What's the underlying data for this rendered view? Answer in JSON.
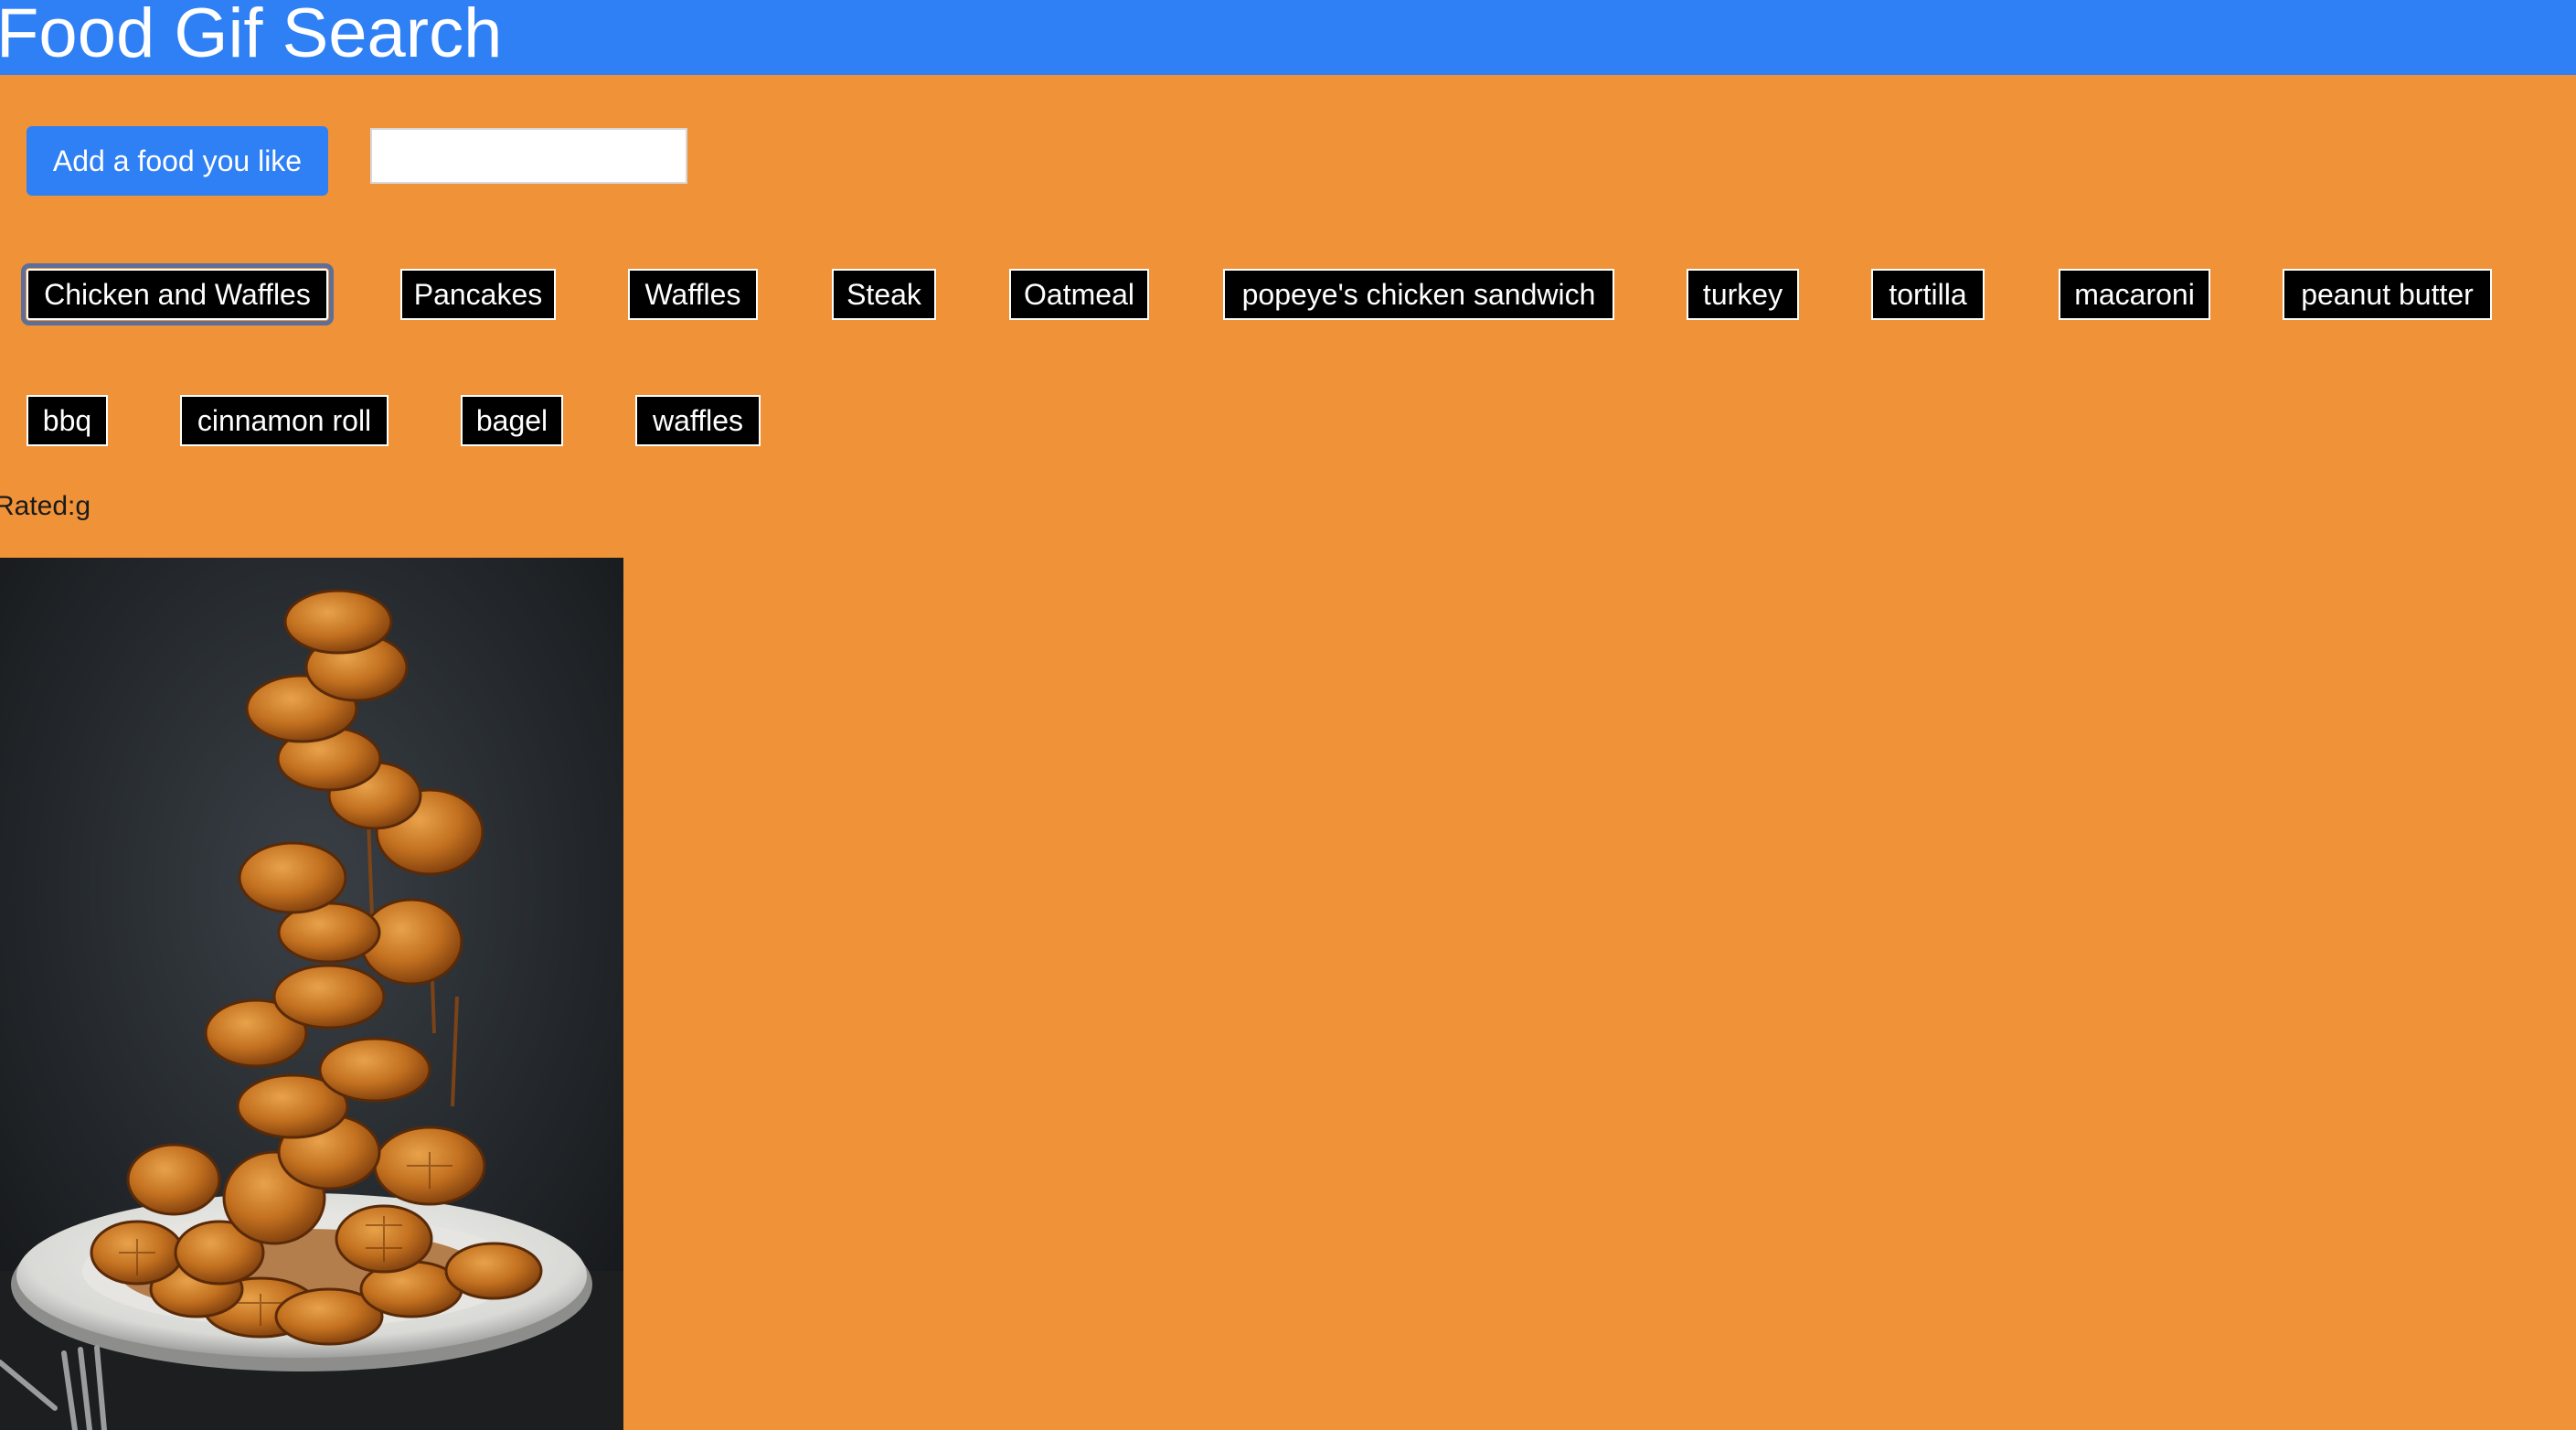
{
  "header": {
    "title": "Food Gif Search"
  },
  "controls": {
    "add_button_label": "Add a food you like",
    "input_value": "",
    "input_placeholder": ""
  },
  "foods": [
    "Chicken and Waffles",
    "Pancakes",
    "Waffles",
    "Steak",
    "Oatmeal",
    "popeye's chicken sandwich",
    "turkey",
    "tortilla",
    "macaroni",
    "peanut butter",
    "bbq",
    "cinnamon roll",
    "bagel",
    "waffles"
  ],
  "selected_food": "Chicken and Waffles",
  "result": {
    "rating_text": "Rated:g",
    "image_subject": "tower of mini waffles with syrup on a plate"
  },
  "colors": {
    "page_background": "#f09237",
    "header_background": "#2f80f4",
    "button_blue": "#2f80f4",
    "food_button_background": "#000000",
    "food_button_text": "#ffffff"
  }
}
